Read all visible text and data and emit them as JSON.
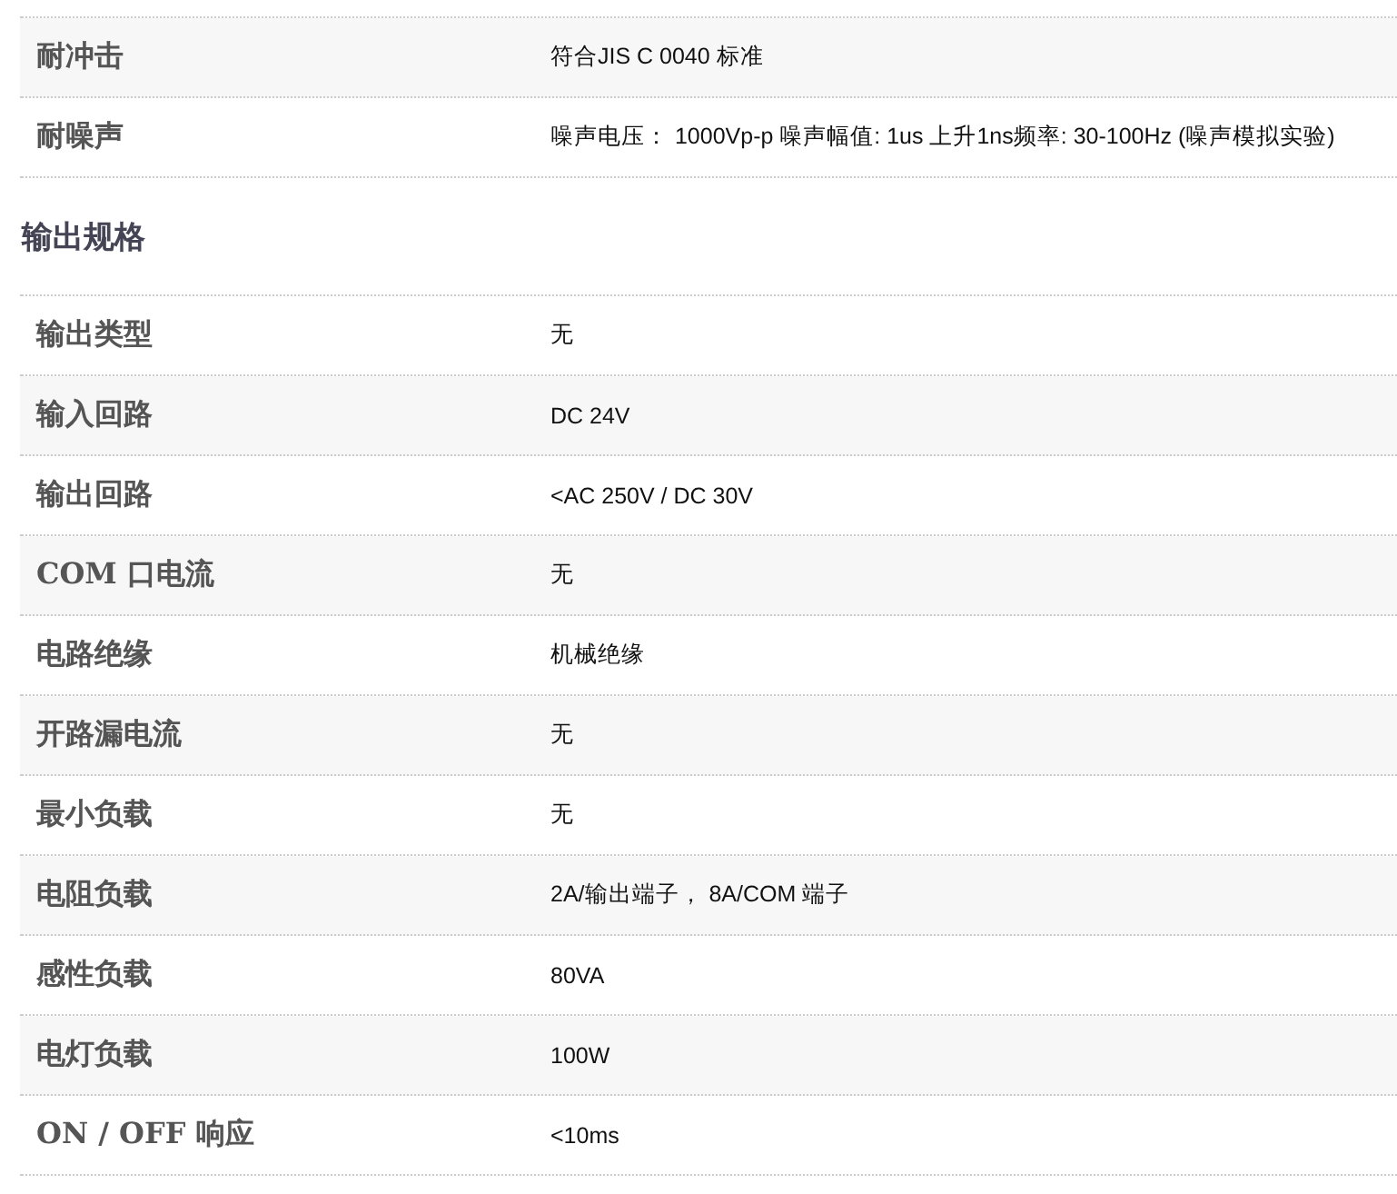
{
  "sections": [
    {
      "rows": [
        {
          "label": "耐冲击",
          "value": "符合JIS C 0040 标准"
        },
        {
          "label": "耐噪声",
          "value": "噪声电压： 1000Vp-p 噪声幅值: 1us 上升1ns频率: 30-100Hz (噪声模拟实验)"
        }
      ]
    },
    {
      "heading": "输出规格",
      "rows": [
        {
          "label": "输出类型",
          "value": "无"
        },
        {
          "label": "输入回路",
          "value": "DC 24V"
        },
        {
          "label": "输出回路",
          "value": "<AC 250V / DC 30V"
        },
        {
          "label": "COM 口电流",
          "value": "无"
        },
        {
          "label": "电路绝缘",
          "value": "机械绝缘"
        },
        {
          "label": "开路漏电流",
          "value": "无"
        },
        {
          "label": "最小负载",
          "value": "无"
        },
        {
          "label": "电阻负载",
          "value": "2A/输出端子， 8A/COM 端子"
        },
        {
          "label": "感性负载",
          "value": "80VA"
        },
        {
          "label": "电灯负载",
          "value": "100W"
        },
        {
          "label": "ON / OFF 响应",
          "value": "<10ms"
        }
      ]
    }
  ]
}
